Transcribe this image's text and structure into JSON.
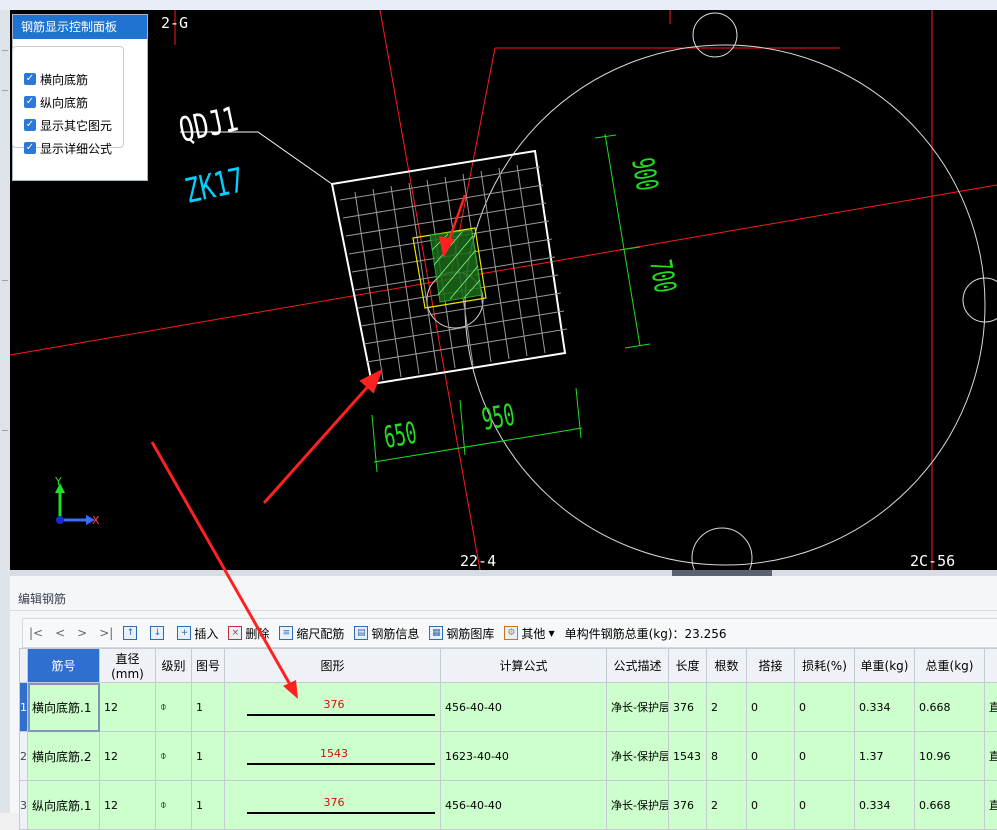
{
  "cad": {
    "component_label": "QDJ1",
    "pile_label": "ZK17",
    "axis_top_left": "2-G",
    "axis_bottom_mid": "22-4",
    "axis_bottom_right": "2C-56",
    "dim_900": "900",
    "dim_700": "700",
    "dim_650": "650",
    "dim_950": "950",
    "axis_y": "Y",
    "axis_x": "X",
    "colors": {
      "background": "#000000",
      "rebar": "#ffffff",
      "dimension": "#00ff00",
      "axis": "#ff0000",
      "label_cyan": "#00d0ff"
    }
  },
  "panel": {
    "title": "钢筋显示控制面板",
    "options": [
      {
        "label": "横向底筋",
        "checked": true
      },
      {
        "label": "纵向底筋",
        "checked": true
      },
      {
        "label": "显示其它图元",
        "checked": true
      },
      {
        "label": "显示详细公式",
        "checked": true
      }
    ]
  },
  "editor": {
    "title": "编辑钢筋",
    "nav": [
      "|<",
      "<",
      ">",
      ">|"
    ],
    "toolbar": {
      "insert": "插入",
      "delete": "删除",
      "ruler": "缩尺配筋",
      "info": "钢筋信息",
      "library": "钢筋图库",
      "other": "其他",
      "total_label": "单构件钢筋总重(kg)：23.256"
    },
    "columns": [
      "筋号",
      "直径(mm)",
      "级别",
      "图号",
      "图形",
      "计算公式",
      "公式描述",
      "长度",
      "根数",
      "搭接",
      "损耗(%)",
      "单重(kg)",
      "总重(kg)"
    ],
    "rows": [
      {
        "no": "1",
        "name": "横向底筋.1",
        "dia": "12",
        "grade": "⌽",
        "fig": "1",
        "shape": "376",
        "formula": "456-40-40",
        "desc": "净长-保护层-保护层",
        "len": "376",
        "count": "2",
        "lap": "0",
        "loss": "0",
        "unit": "0.334",
        "total": "0.668",
        "extra": "直"
      },
      {
        "no": "2",
        "name": "横向底筋.2",
        "dia": "12",
        "grade": "⌽",
        "fig": "1",
        "shape": "1543",
        "formula": "1623-40-40",
        "desc": "净长-保护层-保护层",
        "len": "1543",
        "count": "8",
        "lap": "0",
        "loss": "0",
        "unit": "1.37",
        "total": "10.96",
        "extra": "直"
      },
      {
        "no": "3",
        "name": "纵向底筋.1",
        "dia": "12",
        "grade": "⌽",
        "fig": "1",
        "shape": "376",
        "formula": "456-40-40",
        "desc": "净长-保护层-保护层",
        "len": "376",
        "count": "2",
        "lap": "0",
        "loss": "0",
        "unit": "0.334",
        "total": "0.668",
        "extra": "直"
      }
    ]
  }
}
